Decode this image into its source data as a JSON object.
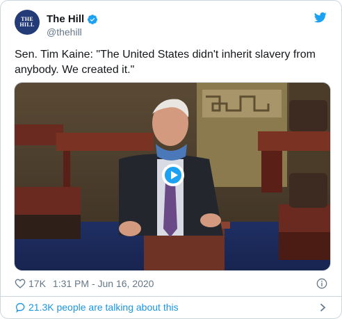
{
  "account": {
    "name": "The Hill",
    "handle": "@thehill",
    "avatar_text_line1": "THE",
    "avatar_text_line2": "HILL"
  },
  "tweet": {
    "text": "Sen. Tim Kaine: \"The United States didn't inherit slavery from anybody. We created it.\""
  },
  "meta": {
    "likes": "17K",
    "timestamp": "1:31 PM - Jun 16, 2020"
  },
  "footer": {
    "conversation": "21.3K people are talking about this"
  },
  "icons": {
    "verified": "verified-badge-icon",
    "bird": "twitter-bird-icon",
    "heart": "heart-icon",
    "info": "info-icon",
    "bubble": "speech-bubble-icon",
    "chevron": "chevron-right-icon",
    "play": "play-icon"
  },
  "colors": {
    "accent": "#1da1f2",
    "link": "#1b95e0",
    "muted": "#657786",
    "text": "#14171a",
    "border": "#ccd6dd",
    "avatar": "#233b77"
  }
}
